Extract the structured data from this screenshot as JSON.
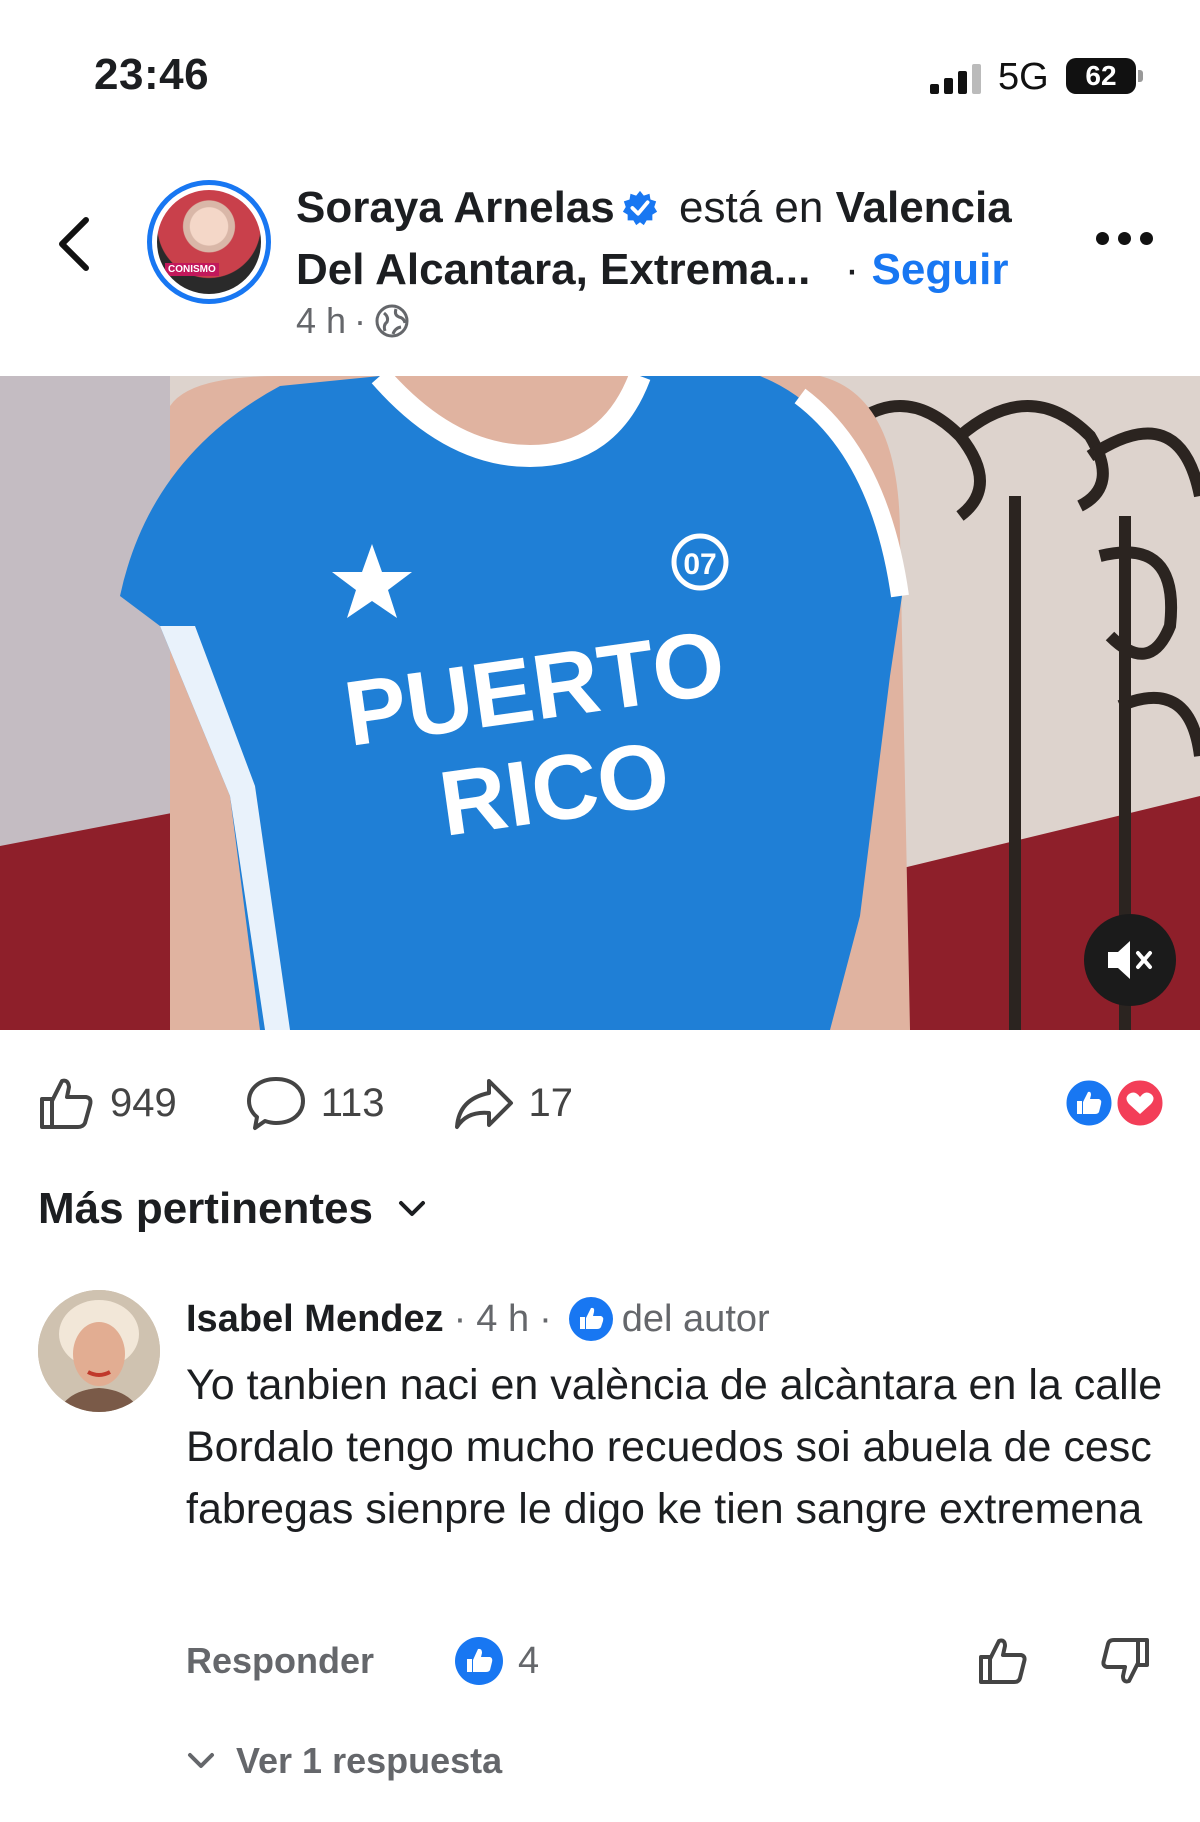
{
  "status_bar": {
    "time": "23:46",
    "network": "5G",
    "battery": "62"
  },
  "post_header": {
    "author": "Soraya Arnelas",
    "location_prefix": "está en",
    "location_line1": "Valencia",
    "location_line2": "Del Alcantara, Extrema...",
    "separator": "·",
    "follow_label": "Seguir",
    "time": "4 h",
    "dot": "·",
    "avatar_tag": "CONISMO"
  },
  "media": {
    "shirt_text_line1": "PUERTO",
    "shirt_text_line2": "RICO",
    "badge_number": "07"
  },
  "actions": {
    "likes": "949",
    "comments": "113",
    "shares": "17"
  },
  "sort": {
    "label": "Más pertinentes"
  },
  "comment": {
    "author": "Isabel Mendez",
    "sep1": "·",
    "time": "4 h",
    "sep2": "·",
    "badge_text": "del autor",
    "text": "Yo tanbien naci en valència de alcàntara  en la calle Bordalo tengo mucho recuedos soi abuela de cesc fabregas  sienpre le digo ke tien sangre extremena",
    "reply_label": "Responder",
    "like_count": "4",
    "view_replies": "Ver 1 respuesta"
  },
  "colors": {
    "accent": "#1877f2",
    "love": "#f33e58",
    "text": "#1c1e21",
    "muted": "#65676b"
  }
}
